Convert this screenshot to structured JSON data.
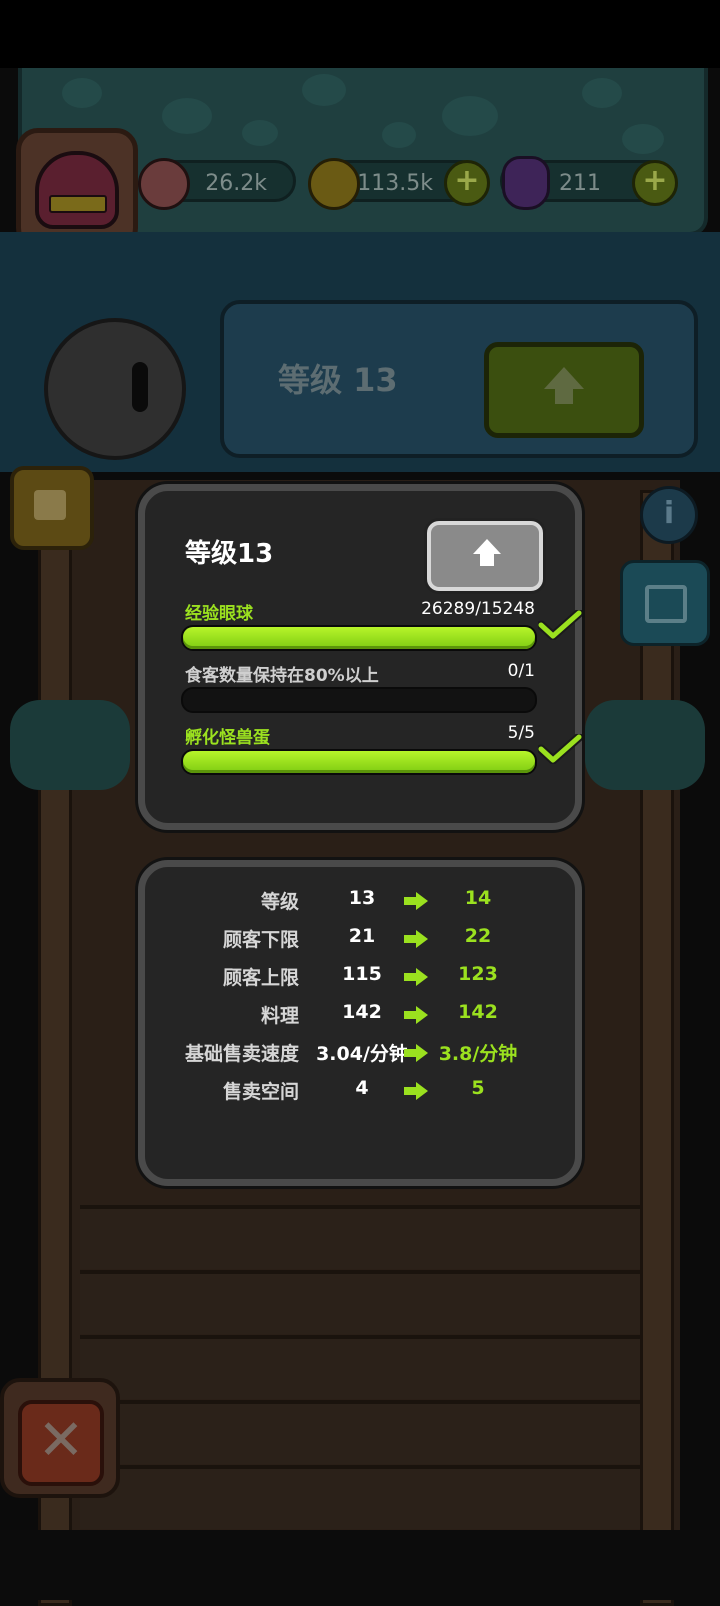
{
  "hud": {
    "eyeballs": "26.2k",
    "coins": "113.5k",
    "potions": "211"
  },
  "background": {
    "level_label": "等级 13"
  },
  "upgrade_panel": {
    "title": "等级13",
    "requirements": [
      {
        "label": "经验眼球",
        "value": "26289/15248",
        "progress": 1.0,
        "met": true,
        "label_color": "#9be11f"
      },
      {
        "label": "食客数量保持在80%以上",
        "value": "0/1",
        "progress": 0.0,
        "met": false,
        "label_color": "#cfcfcf"
      },
      {
        "label": "孵化怪兽蛋",
        "value": "5/5",
        "progress": 1.0,
        "met": true,
        "label_color": "#9be11f"
      }
    ]
  },
  "stats_panel": {
    "rows": [
      {
        "name": "等级",
        "current": "13",
        "next": "14"
      },
      {
        "name": "顾客下限",
        "current": "21",
        "next": "22"
      },
      {
        "name": "顾客上限",
        "current": "115",
        "next": "123"
      },
      {
        "name": "料理",
        "current": "142",
        "next": "142"
      },
      {
        "name": "基础售卖速度",
        "current": "3.04/分钟",
        "next": "3.8/分钟"
      },
      {
        "name": "售卖空间",
        "current": "4",
        "next": "5"
      }
    ]
  },
  "colors": {
    "accent_green": "#9be11f",
    "panel_bg": "#252525"
  }
}
